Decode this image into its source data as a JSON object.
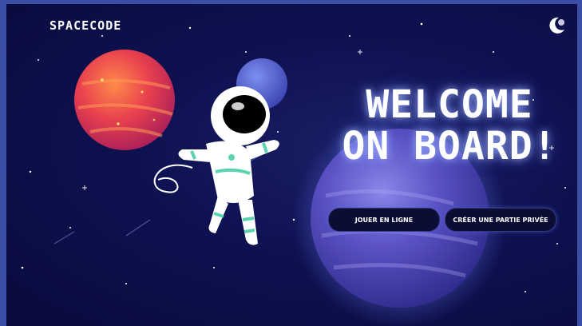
{
  "header": {
    "logo_text": "SPACECODE",
    "theme_toggle_icon": "moon-icon"
  },
  "hero": {
    "headline_line1": "WELCOME",
    "headline_line2": "ON BOARD!"
  },
  "actions": {
    "play_online_label": "JOUER EN LIGNE",
    "create_private_label": "CRÉER UNE PARTIE PRIVÉE"
  },
  "illustration": {
    "icons": [
      "red-planet-icon",
      "blue-planet-icon",
      "large-purple-planet-icon",
      "astronaut-icon"
    ]
  },
  "colors": {
    "background": "#0e1150",
    "frame": "#3a4ea6",
    "button_bg": "#0b0d35",
    "text": "#ffffff"
  }
}
